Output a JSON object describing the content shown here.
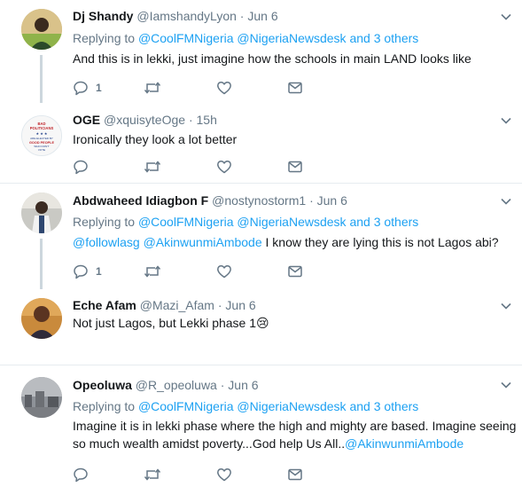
{
  "tweets": [
    {
      "name": "Dj Shandy",
      "handle": "@IamshandyLyon",
      "dot": "·",
      "time": "Jun 6",
      "replying_prefix": "Replying to",
      "mention1": "@CoolFMNigeria",
      "mention2": "@NigeriaNewsdesk",
      "others": "and 3 others",
      "text": "And this is in lekki, just imagine how the schools in main LAND looks like",
      "reply_count": "1"
    },
    {
      "name": "OGE",
      "handle": "@xquisyteOge",
      "dot": "·",
      "time": "15h",
      "text": "Ironically they look a lot better",
      "avatar_text": {
        "line1": "BAD",
        "line2": "POLITICIANS",
        "line3": "ARE ELECTED BY",
        "line4": "GOOD PEOPLE",
        "line5": "WHO DON'T",
        "line6": "VOTE"
      }
    },
    {
      "name": "Abdwaheed Idiagbon F",
      "handle": "@nostynostorm1",
      "dot": "·",
      "time": "Jun 6",
      "replying_prefix": "Replying to",
      "mention1": "@CoolFMNigeria",
      "mention2": "@NigeriaNewsdesk",
      "others": "and 3 others",
      "text_link1": "@followlasg",
      "text_link2": "@AkinwunmiAmbode",
      "text_rest": "I know they are lying this is not Lagos abi?",
      "reply_count": "1"
    },
    {
      "name": "Eche Afam",
      "handle": "@Mazi_Afam",
      "dot": "·",
      "time": "Jun 6",
      "text": "Not just Lagos,  but Lekki phase 1",
      "emoji": "😢"
    },
    {
      "name": "Opeoluwa",
      "handle": "@R_opeoluwa",
      "dot": "·",
      "time": "Jun 6",
      "replying_prefix": "Replying to",
      "mention1": "@CoolFMNigeria",
      "mention2": "@NigeriaNewsdesk",
      "others": "and 3 others",
      "text_line1": "Imagine it is in lekki phase where the high and mighty are based. Imagine seeing",
      "text_line2": "so much wealth amidst poverty...God help Us All..",
      "text_link": "@AkinwunmiAmbode"
    }
  ],
  "colors": {
    "accent": "#1da1f2",
    "secondary_text": "#657786",
    "divider": "#e6ecf0",
    "thread_line": "#ccd6dd"
  },
  "icons": [
    "reply-icon",
    "retweet-icon",
    "like-icon",
    "direct-message-icon",
    "chevron-down-icon"
  ]
}
